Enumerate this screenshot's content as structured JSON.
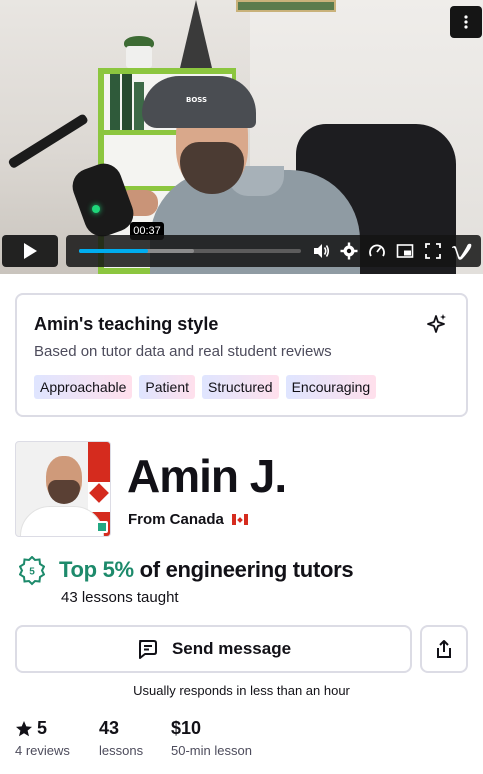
{
  "video": {
    "current_time": "00:37",
    "progress_fraction": 0.31,
    "buffered_fraction": 0.52,
    "cap_text": "BOSS",
    "accent_color": "#00adef",
    "icons": [
      "kebab-menu-icon",
      "play-icon",
      "volume-icon",
      "settings-icon",
      "speed-icon",
      "pip-icon",
      "fullscreen-icon",
      "vimeo-logo-icon"
    ]
  },
  "teaching_style": {
    "title": "Amin's teaching style",
    "subtitle": "Based on tutor data and real student reviews",
    "tags": [
      "Approachable",
      "Patient",
      "Structured",
      "Encouraging"
    ],
    "icon": "sparkle-icon"
  },
  "profile": {
    "name": "Amin J.",
    "from": "From Canada",
    "online": true,
    "badge_number": "5",
    "top_accent": "Top 5%",
    "top_rest": " of engineering tutors",
    "lessons_taught": "43 lessons taught",
    "accent_color": "#1d8a6b"
  },
  "actions": {
    "send_message": "Send message",
    "responds": "Usually responds in less than an hour"
  },
  "stats": [
    {
      "value": "5",
      "label": "4 reviews",
      "icon": "star-icon"
    },
    {
      "value": "43",
      "label": "lessons"
    },
    {
      "value": "$10",
      "label": "50-min lesson"
    }
  ]
}
